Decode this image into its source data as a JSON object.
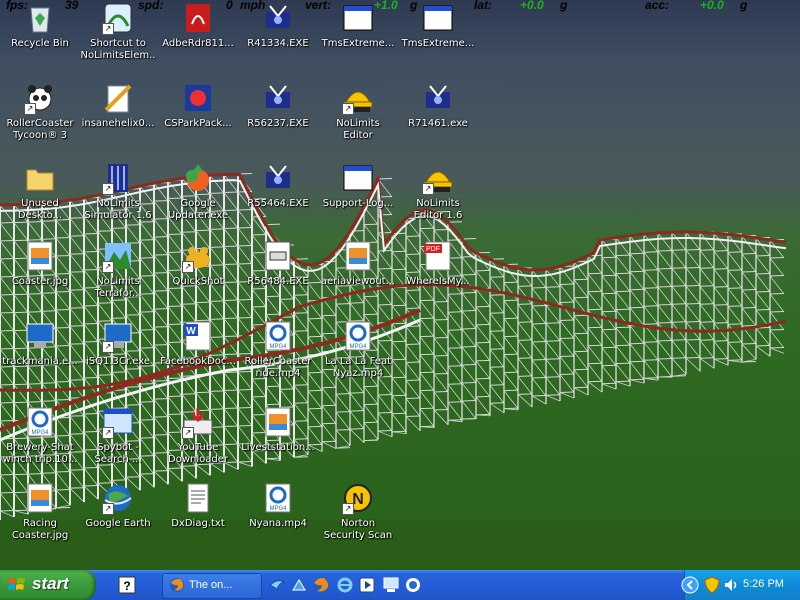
{
  "hud": {
    "items": [
      "fps:",
      "39",
      "spd:",
      "0",
      "mph",
      "vert:",
      "+1.0",
      "g",
      "lat:",
      "+0.0",
      "g",
      "acc:",
      "+0.0",
      "g"
    ]
  },
  "desktop_icons": [
    {
      "label": "Recycle Bin",
      "icon": "recycle-bin-icon",
      "shortcut": false
    },
    {
      "label": "Shortcut to NoLimitsElem...",
      "icon": "shortcut-icon",
      "shortcut": true
    },
    {
      "label": "AdbeRdr811...",
      "icon": "adobe-reader-icon",
      "shortcut": false
    },
    {
      "label": "R41334.EXE",
      "icon": "installer-icon",
      "shortcut": false
    },
    {
      "label": "TmsExtreme...",
      "icon": "window-icon",
      "shortcut": false
    },
    {
      "label": "TmsExtreme...",
      "icon": "window-icon",
      "shortcut": false
    },
    {
      "label": "RollerCoaster Tycoon® 3",
      "icon": "panda-icon",
      "shortcut": true
    },
    {
      "label": "insanehelix0...",
      "icon": "paint-icon",
      "shortcut": false
    },
    {
      "label": "CSParkPack...",
      "icon": "archive-icon",
      "shortcut": false
    },
    {
      "label": "R56237.EXE",
      "icon": "installer-icon",
      "shortcut": false
    },
    {
      "label": "NoLimits Editor",
      "icon": "hardhat-icon",
      "shortcut": true
    },
    {
      "label": "R71461.exe",
      "icon": "installer-icon",
      "shortcut": false
    },
    {
      "label": "Unused Deskto...",
      "icon": "folder-icon",
      "shortcut": false
    },
    {
      "label": "NoLimits Simulator 1.6",
      "icon": "simulator-icon",
      "shortcut": true
    },
    {
      "label": "Google Updater.exe",
      "icon": "google-updater-icon",
      "shortcut": false
    },
    {
      "label": "R55464.EXE",
      "icon": "installer-icon",
      "shortcut": false
    },
    {
      "label": "Support-Log...",
      "icon": "window-icon",
      "shortcut": false
    },
    {
      "label": "NoLimits Editor 1.6",
      "icon": "hardhat-icon",
      "shortcut": true
    },
    {
      "label": "Coaster.jpg",
      "icon": "image-icon",
      "shortcut": false
    },
    {
      "label": "NoLimits Terrafor...",
      "icon": "terrain-icon",
      "shortcut": true
    },
    {
      "label": "QuickShot",
      "icon": "frog-icon",
      "shortcut": true
    },
    {
      "label": "R56484.EXE",
      "icon": "exe-icon",
      "shortcut": false
    },
    {
      "label": "aeriaviewout...",
      "icon": "image-icon",
      "shortcut": false
    },
    {
      "label": "WhereIsMy...",
      "icon": "pdf-icon",
      "shortcut": false
    },
    {
      "label": "trackmania.e...",
      "icon": "game-icon",
      "shortcut": false
    },
    {
      "label": "iSQ1.3Cr.exe",
      "icon": "game-icon",
      "shortcut": true
    },
    {
      "label": "FacebookDoc...",
      "icon": "word-icon",
      "shortcut": false
    },
    {
      "label": "RollerCoaster ride.mp4",
      "icon": "mp4-icon",
      "shortcut": false
    },
    {
      "label": "La La La Feat Nyaz.mp4",
      "icon": "mp4-icon",
      "shortcut": false
    },
    {
      "label": "Brewery-Shat winch trip.10...",
      "icon": "mp4-icon",
      "shortcut": false
    },
    {
      "label": "Spybot - Search ...",
      "icon": "spybot-icon",
      "shortcut": true
    },
    {
      "label": "YouTube Downloader",
      "icon": "downloader-icon",
      "shortcut": true
    },
    {
      "label": "Liveststation...",
      "icon": "image-icon",
      "shortcut": false
    },
    {
      "label": "Racing Coaster.jpg",
      "icon": "image-icon",
      "shortcut": false
    },
    {
      "label": "Google Earth",
      "icon": "google-earth-icon",
      "shortcut": true
    },
    {
      "label": "DxDiag.txt",
      "icon": "text-file-icon",
      "shortcut": false
    },
    {
      "label": "Nyana.mp4",
      "icon": "mp4-icon",
      "shortcut": false
    },
    {
      "label": "Norton Security Scan",
      "icon": "norton-icon",
      "shortcut": true
    }
  ],
  "taskbar": {
    "start_label": "start",
    "task_label": "The on...",
    "clock": "5:26 PM"
  },
  "colors": {
    "taskbar": "#245edb",
    "start": "#3a9a3a",
    "tray": "#0f8bd8",
    "hud_green": "#1fb01f"
  }
}
